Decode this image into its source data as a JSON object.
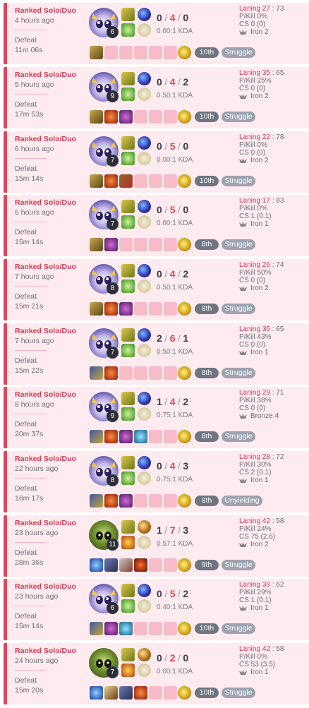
{
  "colors": {
    "defeat_bg": "#fdebef",
    "defeat_accent": "#e0455c",
    "empty_slot": "#f7bcc8",
    "pill": "#9da3ae"
  },
  "matches": [
    {
      "queue": "Ranked Solo/Duo",
      "time_ago": "4 hours ago",
      "result": "Defeat",
      "duration": "11m 06s",
      "champion": "yuumi-portrait",
      "level": "6",
      "spells": [
        "exhaust-icon",
        "cleanse-icon"
      ],
      "runes": [
        "arcane-comet-icon",
        "resolve-tree-icon"
      ],
      "k": "0",
      "d": "4",
      "a": "0",
      "kda": "0.00:1 KDA",
      "items": [
        "spellthief-edge-icon",
        "empty",
        "empty",
        "empty",
        "empty",
        "empty"
      ],
      "ward": "stealth-ward-icon",
      "placement": "10th",
      "badge": "Struggle",
      "laning": "27",
      "laning_opp": "73",
      "pkill": "P/Kill 0%",
      "cs": "CS 0 (0)",
      "tier": "Iron 2"
    },
    {
      "queue": "Ranked Solo/Duo",
      "time_ago": "5 hours ago",
      "result": "Defeat",
      "duration": "17m 53s",
      "champion": "yuumi-portrait",
      "level": "9",
      "spells": [
        "exhaust-icon",
        "cleanse-icon"
      ],
      "runes": [
        "arcane-comet-icon",
        "resolve-tree-icon"
      ],
      "k": "0",
      "d": "4",
      "a": "2",
      "kda": "0.50:1 KDA",
      "items": [
        "spellthief-edge-icon",
        "ignite-item-icon",
        "bandleglass-icon",
        "empty",
        "empty",
        "empty"
      ],
      "ward": "stealth-ward-icon",
      "placement": "10th",
      "badge": "Struggle",
      "laning": "35",
      "laning_opp": "65",
      "pkill": "P/Kill 25%",
      "cs": "CS 0 (0)",
      "tier": "Iron 2"
    },
    {
      "queue": "Ranked Solo/Duo",
      "time_ago": "6 hours ago",
      "result": "Defeat",
      "duration": "15m 14s",
      "champion": "yuumi-portrait",
      "level": "7",
      "spells": [
        "exhaust-icon",
        "cleanse-icon"
      ],
      "runes": [
        "arcane-comet-icon",
        "resolve-tree-icon"
      ],
      "k": "0",
      "d": "5",
      "a": "0",
      "kda": "0.00:1 KDA",
      "items": [
        "spellthief-edge-icon",
        "ignite-item-icon",
        "fiendish-codex-icon",
        "empty",
        "empty",
        "empty"
      ],
      "ward": "stealth-ward-icon",
      "placement": "10th",
      "badge": "Struggle",
      "laning": "22",
      "laning_opp": "78",
      "pkill": "P/Kill 0%",
      "cs": "CS 0 (0)",
      "tier": "Iron 2"
    },
    {
      "queue": "Ranked Solo/Duo",
      "time_ago": "6 hours ago",
      "result": "Defeat",
      "duration": "15m 14s",
      "champion": "yuumi-portrait",
      "level": "7",
      "spells": [
        "exhaust-icon",
        "cleanse-icon"
      ],
      "runes": [
        "arcane-comet-icon",
        "resolve-tree-icon"
      ],
      "k": "0",
      "d": "5",
      "a": "0",
      "kda": "0.00:1 KDA",
      "items": [
        "spellthief-edge-icon",
        "bandleglass-icon",
        "empty",
        "empty",
        "empty",
        "empty"
      ],
      "ward": "stealth-ward-icon",
      "placement": "8th",
      "badge": "Struggle",
      "laning": "17",
      "laning_opp": "83",
      "pkill": "P/Kill 0%",
      "cs": "CS 1 (0.1)",
      "tier": "Iron 1"
    },
    {
      "queue": "Ranked Solo/Duo",
      "time_ago": "7 hours ago",
      "result": "Defeat",
      "duration": "15m 21s",
      "champion": "yuumi-portrait",
      "level": "8",
      "spells": [
        "exhaust-icon",
        "cleanse-icon"
      ],
      "runes": [
        "arcane-comet-icon",
        "resolve-tree-icon"
      ],
      "k": "0",
      "d": "4",
      "a": "2",
      "kda": "0.50:1 KDA",
      "items": [
        "spellthief-edge-icon",
        "ignite-item-icon",
        "bandleglass-icon",
        "empty",
        "empty",
        "empty"
      ],
      "ward": "stealth-ward-icon",
      "placement": "8th",
      "badge": "Struggle",
      "laning": "26",
      "laning_opp": "74",
      "pkill": "P/Kill 50%",
      "cs": "CS 0 (0)",
      "tier": "Iron 2"
    },
    {
      "queue": "Ranked Solo/Duo",
      "time_ago": "7 hours ago",
      "result": "Defeat",
      "duration": "15m 22s",
      "champion": "yuumi-portrait",
      "level": "7",
      "spells": [
        "exhaust-icon",
        "cleanse-icon"
      ],
      "runes": [
        "arcane-comet-icon",
        "resolve-tree-icon"
      ],
      "k": "2",
      "d": "6",
      "a": "1",
      "kda": "0.50:1 KDA",
      "items": [
        "dark-seal-icon",
        "ignite-item-icon",
        "empty",
        "empty",
        "empty",
        "empty"
      ],
      "ward": "stealth-ward-icon",
      "placement": "8th",
      "badge": "Struggle",
      "laning": "35",
      "laning_opp": "65",
      "pkill": "P/Kill 43%",
      "cs": "CS 0 (0)",
      "tier": "Iron 1"
    },
    {
      "queue": "Ranked Solo/Duo",
      "time_ago": "8 hours ago",
      "result": "Defeat",
      "duration": "20m 37s",
      "champion": "yuumi-portrait",
      "level": "9",
      "spells": [
        "exhaust-icon",
        "cleanse-icon"
      ],
      "runes": [
        "arcane-comet-icon",
        "resolve-tree-icon"
      ],
      "k": "1",
      "d": "4",
      "a": "2",
      "kda": "0.75:1 KDA",
      "items": [
        "dark-seal-icon",
        "ignite-item-icon",
        "bandleglass-icon",
        "glacial-icon",
        "empty",
        "empty"
      ],
      "ward": "stealth-ward-icon",
      "placement": "8th",
      "badge": "Struggle",
      "laning": "29",
      "laning_opp": "71",
      "pkill": "P/Kill 38%",
      "cs": "CS 0 (0)",
      "tier": "Bronze 4"
    },
    {
      "queue": "Ranked Solo/Duo",
      "time_ago": "22 hours ago",
      "result": "Defeat",
      "duration": "16m 17s",
      "champion": "yuumi-portrait",
      "level": "8",
      "spells": [
        "exhaust-icon",
        "cleanse-icon"
      ],
      "runes": [
        "arcane-comet-icon",
        "resolve-tree-icon"
      ],
      "k": "0",
      "d": "4",
      "a": "3",
      "kda": "0.75:1 KDA",
      "items": [
        "dark-seal-icon",
        "ignite-item-icon",
        "bandleglass-icon",
        "empty",
        "empty",
        "empty"
      ],
      "ward": "stealth-ward-icon",
      "placement": "8th",
      "badge": "Unyielding",
      "laning": "28",
      "laning_opp": "72",
      "pkill": "P/Kill 30%",
      "cs": "CS 2 (0.1)",
      "tier": "Iron 1"
    },
    {
      "queue": "Ranked Solo/Duo",
      "time_ago": "23 hours ago",
      "result": "Defeat",
      "duration": "28m 36s",
      "champion": "amumu-portrait",
      "level": "11",
      "spells": [
        "exhaust-icon",
        "ignite-icon"
      ],
      "runes": [
        "conqueror-icon",
        "resolve-tree-icon"
      ],
      "k": "1",
      "d": "7",
      "a": "3",
      "kda": "0.57:1 KDA",
      "items": [
        "hailblade-icon",
        "mercury-treads-icon",
        "pickaxe-icon",
        "sunfire-icon",
        "empty",
        "empty"
      ],
      "ward": "stealth-ward-icon",
      "placement": "9th",
      "badge": "Struggle",
      "laning": "42",
      "laning_opp": "58",
      "pkill": "P/Kill 24%",
      "cs": "CS 75 (2.6)",
      "tier": "Iron 2"
    },
    {
      "queue": "Ranked Solo/Duo",
      "time_ago": "23 hours ago",
      "result": "Defeat",
      "duration": "15m 14s",
      "champion": "yuumi-portrait",
      "level": "6",
      "spells": [
        "exhaust-icon",
        "cleanse-icon"
      ],
      "runes": [
        "arcane-comet-icon",
        "resolve-tree-icon"
      ],
      "k": "0",
      "d": "5",
      "a": "2",
      "kda": "0.40:1 KDA",
      "items": [
        "dark-seal-icon",
        "bandleglass-icon",
        "glacial-icon",
        "empty",
        "empty",
        "empty"
      ],
      "ward": "stealth-ward-icon",
      "placement": "10th",
      "badge": "Struggle",
      "laning": "38",
      "laning_opp": "62",
      "pkill": "P/Kill 29%",
      "cs": "CS 1 (0.1)",
      "tier": "Iron 1"
    },
    {
      "queue": "Ranked Solo/Duo",
      "time_ago": "24 hours ago",
      "result": "Defeat",
      "duration": "15m 20s",
      "champion": "amumu-portrait",
      "level": "7",
      "spells": [
        "exhaust-icon",
        "ignite-icon"
      ],
      "runes": [
        "conqueror-icon",
        "resolve-tree-icon"
      ],
      "k": "0",
      "d": "2",
      "a": "0",
      "kda": "0.00:1 KDA",
      "items": [
        "hailblade-icon",
        "sword-icon",
        "mercury-treads-icon",
        "ignite-item-icon",
        "empty",
        "empty"
      ],
      "ward": "stealth-ward-icon",
      "placement": "10th",
      "badge": "Struggle",
      "laning": "42",
      "laning_opp": "58",
      "pkill": "P/Kill 0%",
      "cs": "CS 53 (3.5)",
      "tier": "Iron 1"
    }
  ]
}
